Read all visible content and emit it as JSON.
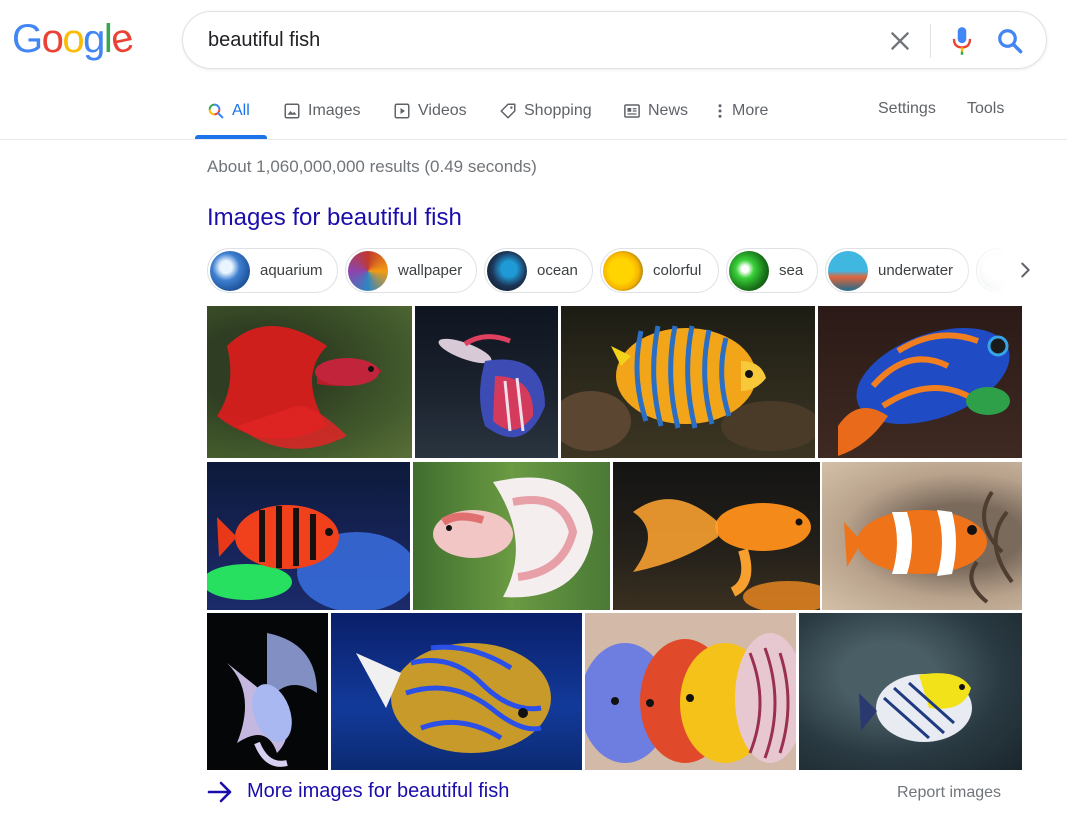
{
  "logo": {
    "letters": [
      "G",
      "o",
      "o",
      "g",
      "l",
      "e"
    ],
    "colors": [
      "#4285f4",
      "#ea4335",
      "#fbbc05",
      "#4285f4",
      "#34a853",
      "#ea4335"
    ]
  },
  "search": {
    "query": "beautiful fish",
    "clear_icon": "close-icon",
    "mic_icon": "microphone-icon",
    "search_icon": "magnifier-icon"
  },
  "tabs": {
    "items": [
      {
        "label": "All",
        "icon": "search-icon",
        "active": true
      },
      {
        "label": "Images",
        "icon": "image-icon"
      },
      {
        "label": "Videos",
        "icon": "play-icon"
      },
      {
        "label": "Shopping",
        "icon": "tag-icon"
      },
      {
        "label": "News",
        "icon": "newspaper-icon"
      },
      {
        "label": "More",
        "icon": "more-vertical-icon"
      }
    ],
    "settings": "Settings",
    "tools": "Tools"
  },
  "results": {
    "stats": "About 1,060,000,000 results (0.49 seconds)",
    "images_heading": "Images for beautiful fish",
    "chips": [
      "aquarium",
      "wallpaper",
      "ocean",
      "colorful",
      "sea",
      "underwater"
    ],
    "more_images": "More images for beautiful fish",
    "report_images": "Report images"
  },
  "colors": {
    "accent": "#1a73e8",
    "link": "#1a0dab",
    "muted": "#70757a"
  }
}
